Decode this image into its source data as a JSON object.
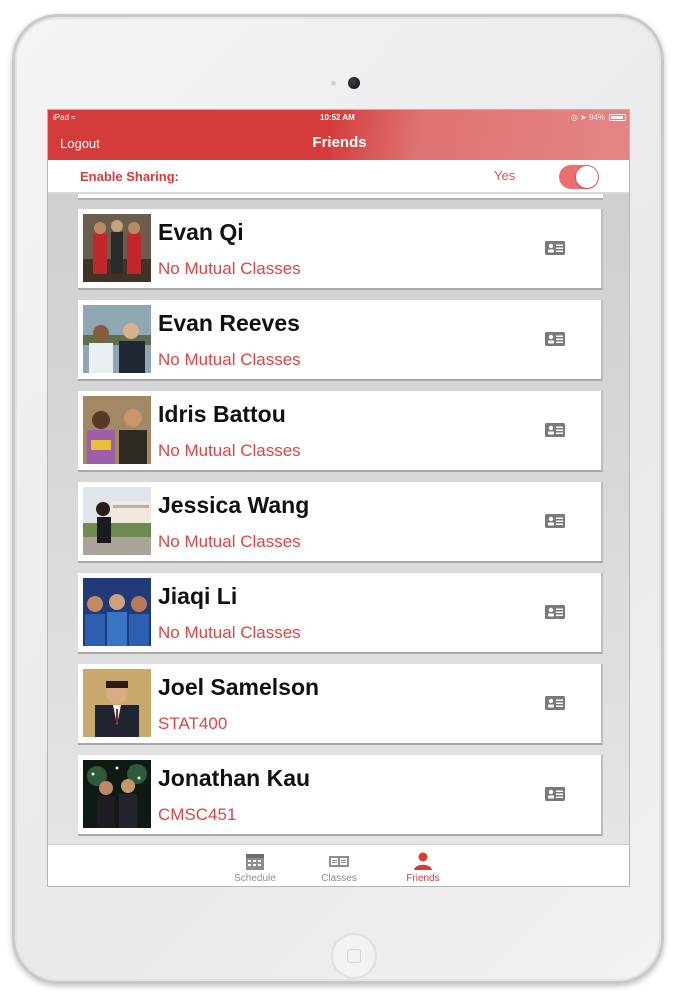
{
  "status_bar": {
    "carrier": "iPad",
    "time": "10:52 AM",
    "battery": "94%"
  },
  "header": {
    "title": "Friends",
    "logout_label": "Logout"
  },
  "sharing": {
    "label": "Enable Sharing:",
    "value": "Yes",
    "enabled": true
  },
  "friends": [
    {
      "name": "Evan Qi",
      "classes": "No Mutual Classes"
    },
    {
      "name": "Evan Reeves",
      "classes": "No Mutual Classes"
    },
    {
      "name": "Idris Battou",
      "classes": "No Mutual Classes"
    },
    {
      "name": "Jessica Wang",
      "classes": "No Mutual Classes"
    },
    {
      "name": "Jiaqi Li",
      "classes": "No Mutual Classes"
    },
    {
      "name": "Joel Samelson",
      "classes": "STAT400"
    },
    {
      "name": "Jonathan Kau",
      "classes": "CMSC451"
    }
  ],
  "tabs": [
    {
      "label": "Schedule",
      "icon": "calendar-icon",
      "active": false
    },
    {
      "label": "Classes",
      "icon": "classes-icon",
      "active": false
    },
    {
      "label": "Friends",
      "icon": "person-icon",
      "active": true
    }
  ],
  "colors": {
    "accent": "#d43c3c",
    "class_text": "#d84545",
    "inactive_tab": "#8e8e8e"
  }
}
